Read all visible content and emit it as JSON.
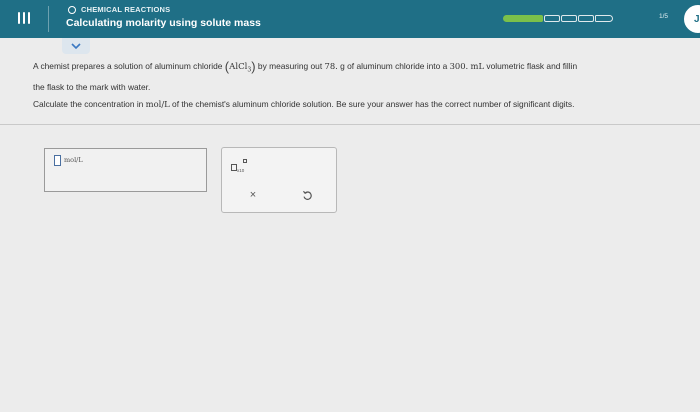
{
  "header": {
    "topic": "CHEMICAL REACTIONS",
    "title": "Calculating molarity using solute mass",
    "progress": {
      "filled": 1,
      "total": 5,
      "count_label": "1/5"
    },
    "avatar_initial": "J"
  },
  "question": {
    "text_before_formula": "A chemist prepares a solution of aluminum chloride",
    "formula_base": "AlCl",
    "formula_sub": "3",
    "text_mid1": "by measuring out",
    "mass_value": "78.",
    "text_mid2": "g of aluminum chloride into a",
    "volume_value": "300.",
    "volume_unit": "mL",
    "text_end_line1": "volumetric flask and fillin",
    "text_line2": "the flask to the mark with water."
  },
  "prompt": {
    "before": "Calculate the concentration in",
    "unit": "mol/L",
    "after": "of the chemist's aluminum chloride solution. Be sure your answer has the correct number of significant digits."
  },
  "answer": {
    "value": "",
    "unit": "mol/L"
  },
  "tools": {
    "sci_notation_label": "x10",
    "clear_symbol": "×",
    "undo_symbol": "↺"
  },
  "colors": {
    "header_bg": "#1f6f86",
    "progress_fill": "#7bc04a",
    "page_bg": "#ececec"
  }
}
